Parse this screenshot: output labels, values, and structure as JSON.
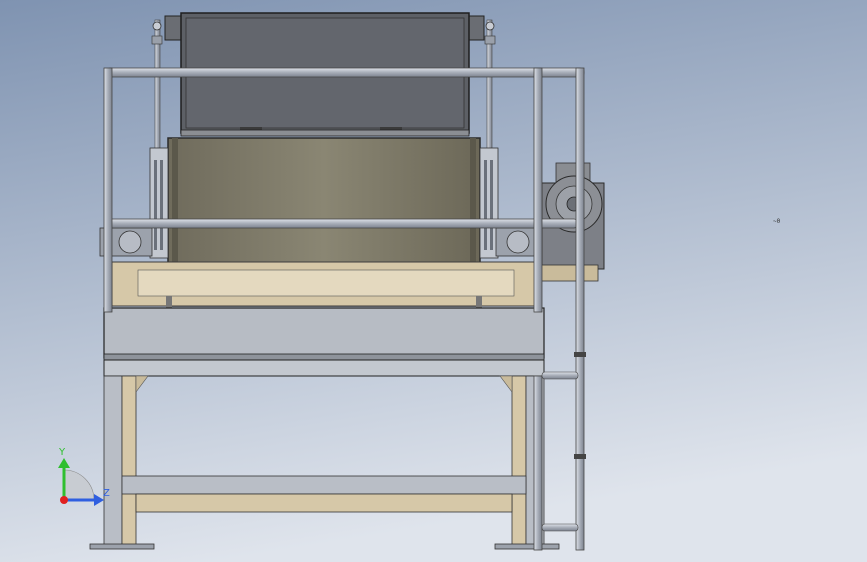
{
  "viewport": {
    "background_top": "#7f93b1",
    "background_bottom": "#dfe4ec"
  },
  "model": {
    "frame_color": "#d6c8a8",
    "frame_edge": "#4a4a4a",
    "steel_color": "#b9bec8",
    "drum_color": "#7f7b6a",
    "panel_color": "#5d6066",
    "rail_color": "#aeb4be"
  },
  "triad": {
    "x_label": "Z",
    "y_label": "Y",
    "y_color": "#2fbf2f",
    "z_color": "#2f5fe0",
    "origin_color": "#e02020"
  },
  "marker": {
    "text": "~0"
  }
}
